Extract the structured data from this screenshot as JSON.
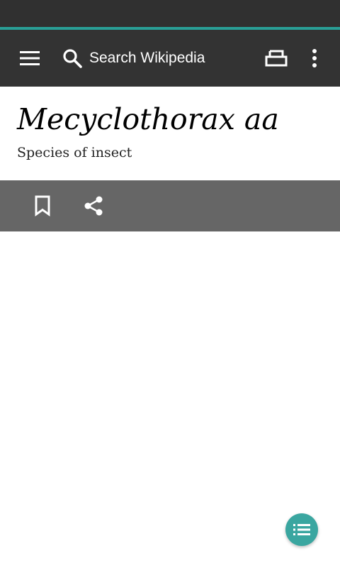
{
  "toolbar": {
    "search_placeholder": "Search Wikipedia",
    "icons": [
      "menu-icon",
      "search-icon",
      "tabs-icon",
      "more-vert-icon"
    ]
  },
  "article": {
    "title": "Mecyclothorax aa",
    "description": "Species of insect"
  },
  "actions": {
    "icons": [
      "bookmark-icon",
      "share-icon"
    ]
  },
  "fab": {
    "icon": "toc-list-icon"
  },
  "colors": {
    "status_bar": "#303030",
    "accent": "#2aa198",
    "toolbar": "#333333",
    "action_bar": "#666666",
    "fab": "#3aa6a0"
  }
}
